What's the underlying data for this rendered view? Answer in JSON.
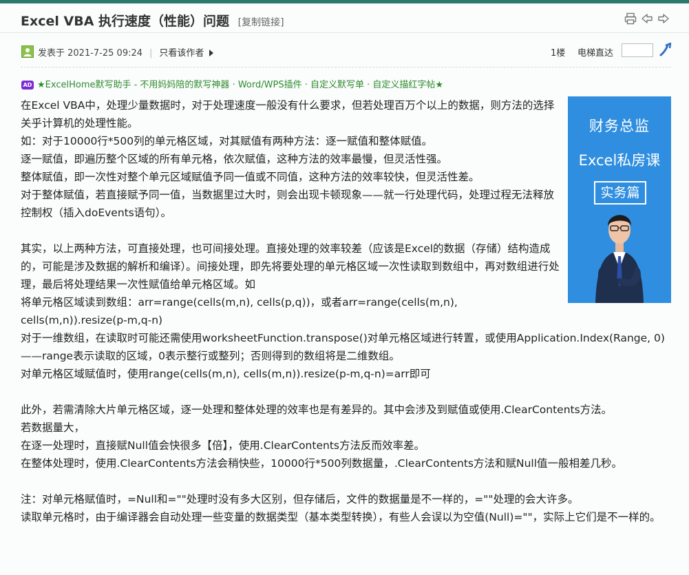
{
  "post": {
    "title": "Excel VBA 执行速度（性能）问题",
    "copy_link": "[复制链接]"
  },
  "meta": {
    "posted_at": "发表于 2021-7-25 09:24",
    "only_author": "只看该作者",
    "floor": "1楼",
    "jump_label": "电梯直达",
    "jump_value": ""
  },
  "ad": {
    "badge": "AD",
    "text": "★ExcelHome默写助手 - 不用妈妈陪的默写神器 · Word/WPS插件 · 自定义默写单 · 自定义描红字帖★"
  },
  "promo": {
    "line1": "财务总监",
    "line2": "Excel私房课",
    "line3": "实务篇"
  },
  "body": [
    "在Excel VBA中，处理少量数据时，对于处理速度一般没有什么要求，但若处理百万个以上的数据，则方法的选择关乎计算机的处理性能。",
    "如：对于10000行*500列的单元格区域，对其赋值有两种方法：逐一赋值和整体赋值。",
    "逐一赋值，即遍历整个区域的所有单元格，依次赋值，这种方法的效率最慢，但灵活性强。",
    "整体赋值，即一次性对整个单元区域赋值予同一值或不同值，这种方法的效率较快，但灵活性差。",
    "对于整体赋值，若直接赋予同一值，当数据里过大时，则会出现卡顿现象——就一行处理代码，处理过程无法释放控制权（插入doEvents语句）。",
    "",
    "其实，以上两种方法，可直接处理，也可间接处理。直接处理的效率较差（应该是Excel的数据（存储）结构造成的，可能是涉及数据的解析和编译）。间接处理，即先将要处理的单元格区域一次性读取到数组中，再对数组进行处理，最后将处理结果一次性赋值给单元格区域。如",
    "将单元格区域读到数组：arr=range(cells(m,n), cells(p,q))，或者arr=range(cells(m,n), cells(m,n)).resize(p-m,q-n)",
    "对于一维数组，在读取时可能还需使用worksheetFunction.transpose()对单元格区域进行转置，或使用Application.Index(Range, 0)——range表示读取的区域，0表示整行或整列；否则得到的数组将是二维数组。",
    "对单元格区域赋值时，使用range(cells(m,n), cells(m,n)).resize(p-m,q-n)=arr即可",
    "",
    "此外，若需清除大片单元格区域，逐一处理和整体处理的效率也是有差异的。其中会涉及到赋值或使用.ClearContents方法。",
    "若数据量大，",
    "在逐一处理时，直接赋Null值会快很多【倍】，使用.ClearContents方法反而效率差。",
    "在整体处理时，使用.ClearContents方法会稍快些，10000行*500列数据量，.ClearContents方法和赋Null值一般相差几秒。",
    "",
    "注：对单元格赋值时，=Null和=\"\"处理时没有多大区别，但存储后，文件的数据量是不一样的，=\"\"处理的会大许多。",
    "读取单元格时，由于编译器会自动处理一些变量的数据类型（基本类型转换），有些人会误以为空值(Null)=\"\"，实际上它们是不一样的。"
  ]
}
